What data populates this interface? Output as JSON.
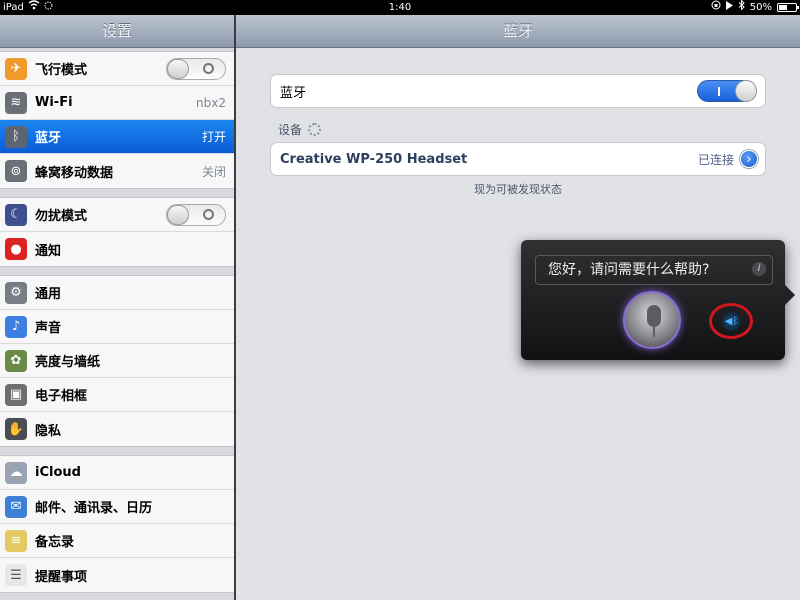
{
  "status_bar": {
    "device": "iPad",
    "time": "1:40",
    "battery_percent": "50%",
    "battery_level": 0.5
  },
  "master": {
    "title": "设置",
    "groups": [
      [
        {
          "label": "飞行模式",
          "icon": "airplane-icon",
          "control": "switch-off"
        },
        {
          "label": "Wi-Fi",
          "icon": "wifi-icon",
          "value": "nbx2"
        },
        {
          "label": "蓝牙",
          "icon": "bluetooth-icon",
          "value": "打开",
          "selected": true
        },
        {
          "label": "蜂窝移动数据",
          "icon": "cellular-icon",
          "value": "关闭"
        }
      ],
      [
        {
          "label": "勿扰模式",
          "icon": "moon-icon",
          "control": "switch-off"
        },
        {
          "label": "通知",
          "icon": "notifications-icon"
        }
      ],
      [
        {
          "label": "通用",
          "icon": "gear-icon"
        },
        {
          "label": "声音",
          "icon": "speaker-icon"
        },
        {
          "label": "亮度与墙纸",
          "icon": "flower-icon"
        },
        {
          "label": "电子相框",
          "icon": "picture-frame-icon"
        },
        {
          "label": "隐私",
          "icon": "hand-icon"
        }
      ],
      [
        {
          "label": "iCloud",
          "icon": "cloud-icon"
        },
        {
          "label": "邮件、通讯录、日历",
          "icon": "mail-icon"
        },
        {
          "label": "备忘录",
          "icon": "notes-icon"
        },
        {
          "label": "提醒事项",
          "icon": "reminders-icon"
        }
      ]
    ]
  },
  "detail": {
    "title": "蓝牙",
    "bluetooth_label": "蓝牙",
    "bluetooth_on": true,
    "devices_header": "设备",
    "device": {
      "name": "Creative WP-250 Headset",
      "status": "已连接"
    },
    "discoverable_note": "现为可被发现状态"
  },
  "siri": {
    "prompt": "您好，请问需要什么帮助?",
    "info_label": "i",
    "audio_route": "bluetooth-audio-icon"
  },
  "colors": {
    "selected_row": "#0b5cd6",
    "switch_on": "#1861da",
    "highlight_ring": "#d3151c"
  }
}
